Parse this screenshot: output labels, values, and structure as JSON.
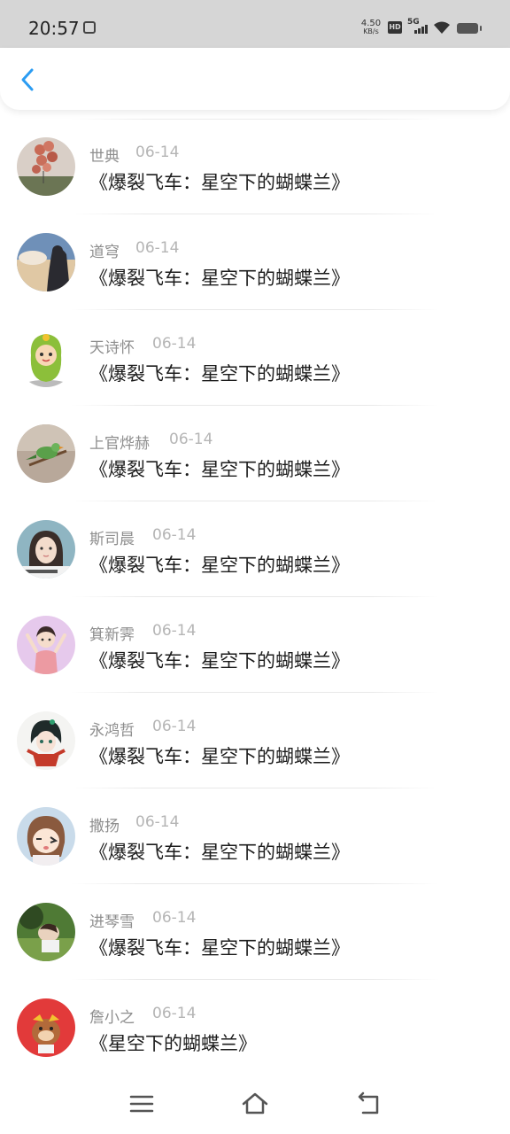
{
  "status_bar": {
    "time": "20:57",
    "net_speed_value": "4.50",
    "net_speed_unit": "KB/s",
    "hd_label": "HD",
    "network_label": "5G"
  },
  "header": {
    "back_icon": "chevron-left-icon",
    "accent_color": "#2b9cf2"
  },
  "messages": [
    {
      "name": "世典",
      "date": "06-14",
      "title": "《爆裂飞车：星空下的蝴蝶兰》",
      "avatar": "balloons-avatar"
    },
    {
      "name": "道穹",
      "date": "06-14",
      "title": "《爆裂飞车：星空下的蝴蝶兰》",
      "avatar": "sky-silhouette-avatar"
    },
    {
      "name": "天诗怀",
      "date": "06-14",
      "title": "《爆裂飞车：星空下的蝴蝶兰》",
      "avatar": "cartoon-costume-avatar"
    },
    {
      "name": "上官烨赫",
      "date": "06-14",
      "title": "《爆裂飞车：星空下的蝴蝶兰》",
      "avatar": "bird-avatar"
    },
    {
      "name": "斯司晨",
      "date": "06-14",
      "title": "《爆裂飞车：星空下的蝴蝶兰》",
      "avatar": "girl-photo-avatar"
    },
    {
      "name": "箕新霁",
      "date": "06-14",
      "title": "《爆裂飞车：星空下的蝴蝶兰》",
      "avatar": "pink-girl-avatar"
    },
    {
      "name": "永鸿哲",
      "date": "06-14",
      "title": "《爆裂飞车：星空下的蝴蝶兰》",
      "avatar": "anime-character-avatar"
    },
    {
      "name": "撒扬",
      "date": "06-14",
      "title": "《爆裂飞车：星空下的蝴蝶兰》",
      "avatar": "cartoon-girl-avatar"
    },
    {
      "name": "进琴雪",
      "date": "06-14",
      "title": "《爆裂飞车：星空下的蝴蝶兰》",
      "avatar": "outdoor-photo-avatar"
    },
    {
      "name": "詹小之",
      "date": "06-14",
      "title": "《星空下的蝴蝶兰》",
      "avatar": "red-cartoon-avatar"
    }
  ],
  "nav_bar": {
    "menu_icon": "menu-icon",
    "home_icon": "home-icon",
    "back_icon": "back-icon"
  }
}
